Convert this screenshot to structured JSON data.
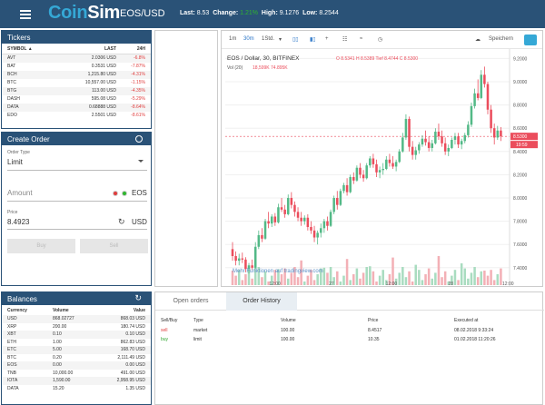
{
  "header": {
    "logo_part1": "Coin",
    "logo_part2": "Sim",
    "pair": "EOS/USD",
    "last_label": "Last:",
    "last_value": "8.53",
    "change_label": "Change:",
    "change_value": "1.21%",
    "high_label": "High:",
    "high_value": "9.1276",
    "low_label": "Low:",
    "low_value": "8.2544"
  },
  "tickers": {
    "title": "Tickers",
    "col_symbol": "SYMBOL ▲",
    "col_last": "LAST",
    "col_24h": "24H",
    "rows": [
      {
        "symbol": "AVT",
        "last": "2.0306 USD",
        "change": "-6.8%"
      },
      {
        "symbol": "BAT",
        "last": "0.3531 USD",
        "change": "-7.87%"
      },
      {
        "symbol": "BCH",
        "last": "1,215.80 USD",
        "change": "-4.31%"
      },
      {
        "symbol": "BTC",
        "last": "10,557.00 USD",
        "change": "-1.15%"
      },
      {
        "symbol": "BTG",
        "last": "113.00 USD",
        "change": "-4.35%"
      },
      {
        "symbol": "DASH",
        "last": "595.08 USD",
        "change": "-5.29%"
      },
      {
        "symbol": "DATA",
        "last": "0.68888 USD",
        "change": "-8.64%"
      },
      {
        "symbol": "EDO",
        "last": "2.5501 USD",
        "change": "-8.61%"
      }
    ]
  },
  "order": {
    "title": "Create Order",
    "type_label": "Order Type",
    "type_value": "Limit",
    "amount_placeholder": "Amount",
    "amount_currency": "EOS",
    "price_label": "Price",
    "price_value": "8.4923",
    "price_currency": "USD",
    "buy_label": "Buy",
    "sell_label": "Sell"
  },
  "balances": {
    "title": "Balances",
    "col_currency": "Currency",
    "col_volume": "Volume",
    "col_value": "Value",
    "rows": [
      {
        "currency": "USD",
        "volume": "868.02727",
        "value": "868.03 USD"
      },
      {
        "currency": "XRP",
        "volume": "200.00",
        "value": "180.74 USD"
      },
      {
        "currency": "XBT",
        "volume": "0.10",
        "value": "0.10 USD"
      },
      {
        "currency": "ETH",
        "volume": "1.00",
        "value": "862.83 USD"
      },
      {
        "currency": "ETC",
        "volume": "5.00",
        "value": "168.70 USD"
      },
      {
        "currency": "BTC",
        "volume": "0.20",
        "value": "2,111.49 USD"
      },
      {
        "currency": "EOS",
        "volume": "0.00",
        "value": "0.00 USD"
      },
      {
        "currency": "TNB",
        "volume": "10,000.00",
        "value": "491.00 USD"
      },
      {
        "currency": "IOTA",
        "volume": "1,590.00",
        "value": "2,958.95 USD"
      },
      {
        "currency": "DATA",
        "volume": "15.20",
        "value": "1.35 USD"
      }
    ]
  },
  "chart_toolbar": {
    "tf_1m": "1m",
    "tf_30m": "30m",
    "tf_1d": "1Std.",
    "save_label": "Speichern"
  },
  "chart_data": {
    "type": "candlestick",
    "title": "EOS / Dollar, 30, BITFINEX",
    "ohlc_o": "O 8.5341",
    "ohlc_h": "H 8.5389",
    "ohlc_l": "Tief 8.4744",
    "ohlc_c": "C 8.5300",
    "vol_label": "Vol (20)",
    "vol_value1": "18,599K",
    "vol_value2": "74.895K",
    "price_tag_current": "8.5300",
    "price_tag_time": "19:59",
    "ylim": [
      7.25,
      9.25
    ],
    "yticks": [
      "9.2000",
      "9.0000",
      "8.8000",
      "8.6000",
      "8.4000",
      "8.2000",
      "8.0000",
      "7.8000",
      "7.6000",
      "7.4000"
    ],
    "xticks": [
      "12:00",
      "27",
      "12:00",
      "28",
      "12:00"
    ],
    "watermark": "Mehr Funktionen auf tradingview.com",
    "candles": [
      {
        "o": 7.56,
        "h": 7.62,
        "l": 7.46,
        "c": 7.5
      },
      {
        "o": 7.5,
        "h": 7.54,
        "l": 7.42,
        "c": 7.46
      },
      {
        "o": 7.46,
        "h": 7.52,
        "l": 7.42,
        "c": 7.48
      },
      {
        "o": 7.48,
        "h": 7.53,
        "l": 7.44,
        "c": 7.47
      },
      {
        "o": 7.47,
        "h": 7.49,
        "l": 7.36,
        "c": 7.39
      },
      {
        "o": 7.39,
        "h": 7.44,
        "l": 7.35,
        "c": 7.42
      },
      {
        "o": 7.42,
        "h": 7.47,
        "l": 7.38,
        "c": 7.4
      },
      {
        "o": 7.4,
        "h": 7.62,
        "l": 7.39,
        "c": 7.58
      },
      {
        "o": 7.58,
        "h": 7.72,
        "l": 7.56,
        "c": 7.68
      },
      {
        "o": 7.68,
        "h": 7.74,
        "l": 7.62,
        "c": 7.65
      },
      {
        "o": 7.65,
        "h": 7.82,
        "l": 7.64,
        "c": 7.8
      },
      {
        "o": 7.8,
        "h": 7.88,
        "l": 7.74,
        "c": 7.78
      },
      {
        "o": 7.78,
        "h": 7.86,
        "l": 7.75,
        "c": 7.84
      },
      {
        "o": 7.84,
        "h": 7.87,
        "l": 7.76,
        "c": 7.79
      },
      {
        "o": 7.79,
        "h": 7.95,
        "l": 7.78,
        "c": 7.92
      },
      {
        "o": 7.92,
        "h": 8.0,
        "l": 7.88,
        "c": 7.9
      },
      {
        "o": 7.9,
        "h": 7.94,
        "l": 7.83,
        "c": 7.86
      },
      {
        "o": 7.86,
        "h": 8.03,
        "l": 7.85,
        "c": 8.0
      },
      {
        "o": 8.0,
        "h": 8.05,
        "l": 7.91,
        "c": 7.94
      },
      {
        "o": 7.94,
        "h": 7.97,
        "l": 7.84,
        "c": 7.88
      },
      {
        "o": 7.88,
        "h": 7.92,
        "l": 7.8,
        "c": 7.83
      },
      {
        "o": 7.83,
        "h": 7.88,
        "l": 7.76,
        "c": 7.8
      },
      {
        "o": 7.8,
        "h": 7.85,
        "l": 7.77,
        "c": 7.83
      },
      {
        "o": 7.83,
        "h": 7.86,
        "l": 7.72,
        "c": 7.75
      },
      {
        "o": 7.75,
        "h": 7.8,
        "l": 7.69,
        "c": 7.72
      },
      {
        "o": 7.72,
        "h": 7.76,
        "l": 7.62,
        "c": 7.66
      },
      {
        "o": 7.66,
        "h": 7.72,
        "l": 7.6,
        "c": 7.7
      },
      {
        "o": 7.7,
        "h": 7.78,
        "l": 7.66,
        "c": 7.74
      },
      {
        "o": 7.74,
        "h": 7.82,
        "l": 7.7,
        "c": 7.8
      },
      {
        "o": 7.8,
        "h": 7.84,
        "l": 7.72,
        "c": 7.76
      },
      {
        "o": 7.76,
        "h": 7.9,
        "l": 7.75,
        "c": 7.88
      },
      {
        "o": 7.88,
        "h": 8.02,
        "l": 7.86,
        "c": 8.0
      },
      {
        "o": 8.0,
        "h": 8.06,
        "l": 7.9,
        "c": 7.94
      },
      {
        "o": 7.94,
        "h": 8.08,
        "l": 7.93,
        "c": 8.06
      },
      {
        "o": 8.06,
        "h": 8.13,
        "l": 8.04,
        "c": 8.11
      },
      {
        "o": 8.11,
        "h": 8.17,
        "l": 8.02,
        "c": 8.05
      },
      {
        "o": 8.05,
        "h": 8.2,
        "l": 8.04,
        "c": 8.18
      },
      {
        "o": 8.18,
        "h": 8.22,
        "l": 8.12,
        "c": 8.15
      },
      {
        "o": 8.15,
        "h": 8.28,
        "l": 8.14,
        "c": 8.26
      },
      {
        "o": 8.26,
        "h": 8.3,
        "l": 8.17,
        "c": 8.2
      },
      {
        "o": 8.2,
        "h": 8.24,
        "l": 8.14,
        "c": 8.17
      },
      {
        "o": 8.17,
        "h": 8.3,
        "l": 8.16,
        "c": 8.28
      },
      {
        "o": 8.28,
        "h": 8.36,
        "l": 8.26,
        "c": 8.34
      },
      {
        "o": 8.34,
        "h": 8.38,
        "l": 8.26,
        "c": 8.29
      },
      {
        "o": 8.29,
        "h": 8.33,
        "l": 8.18,
        "c": 8.22
      },
      {
        "o": 8.22,
        "h": 8.27,
        "l": 8.17,
        "c": 8.24
      },
      {
        "o": 8.24,
        "h": 8.3,
        "l": 8.2,
        "c": 8.25
      },
      {
        "o": 8.25,
        "h": 8.36,
        "l": 8.24,
        "c": 8.33
      },
      {
        "o": 8.33,
        "h": 8.38,
        "l": 8.27,
        "c": 8.3
      },
      {
        "o": 8.3,
        "h": 8.36,
        "l": 8.25,
        "c": 8.27
      },
      {
        "o": 8.27,
        "h": 8.33,
        "l": 8.23,
        "c": 8.31
      },
      {
        "o": 8.31,
        "h": 8.42,
        "l": 8.3,
        "c": 8.4
      },
      {
        "o": 8.4,
        "h": 8.56,
        "l": 8.39,
        "c": 8.52
      },
      {
        "o": 8.52,
        "h": 8.72,
        "l": 8.5,
        "c": 8.68
      },
      {
        "o": 8.68,
        "h": 8.7,
        "l": 8.4,
        "c": 8.44
      },
      {
        "o": 8.44,
        "h": 8.49,
        "l": 8.33,
        "c": 8.37
      },
      {
        "o": 8.37,
        "h": 8.44,
        "l": 8.33,
        "c": 8.41
      },
      {
        "o": 8.41,
        "h": 8.48,
        "l": 8.38,
        "c": 8.46
      },
      {
        "o": 8.46,
        "h": 8.54,
        "l": 8.44,
        "c": 8.51
      },
      {
        "o": 8.51,
        "h": 8.58,
        "l": 8.45,
        "c": 8.48
      },
      {
        "o": 8.48,
        "h": 8.53,
        "l": 8.4,
        "c": 8.43
      },
      {
        "o": 8.43,
        "h": 8.5,
        "l": 8.4,
        "c": 8.47
      },
      {
        "o": 8.47,
        "h": 8.6,
        "l": 8.46,
        "c": 8.57
      },
      {
        "o": 8.57,
        "h": 8.64,
        "l": 8.5,
        "c": 8.53
      },
      {
        "o": 8.53,
        "h": 8.58,
        "l": 8.44,
        "c": 8.47
      },
      {
        "o": 8.47,
        "h": 8.52,
        "l": 8.37,
        "c": 8.4
      },
      {
        "o": 8.4,
        "h": 8.46,
        "l": 8.36,
        "c": 8.43
      },
      {
        "o": 8.43,
        "h": 8.52,
        "l": 8.42,
        "c": 8.5
      },
      {
        "o": 8.5,
        "h": 8.56,
        "l": 8.46,
        "c": 8.53
      },
      {
        "o": 8.53,
        "h": 8.56,
        "l": 8.43,
        "c": 8.46
      },
      {
        "o": 8.46,
        "h": 8.51,
        "l": 8.42,
        "c": 8.49
      },
      {
        "o": 8.49,
        "h": 8.56,
        "l": 8.47,
        "c": 8.54
      },
      {
        "o": 8.54,
        "h": 8.66,
        "l": 8.52,
        "c": 8.63
      },
      {
        "o": 8.63,
        "h": 8.82,
        "l": 8.61,
        "c": 8.79
      },
      {
        "o": 8.79,
        "h": 8.94,
        "l": 8.77,
        "c": 8.9
      },
      {
        "o": 8.9,
        "h": 9.02,
        "l": 8.84,
        "c": 8.86
      },
      {
        "o": 8.86,
        "h": 9.1,
        "l": 8.85,
        "c": 9.06
      },
      {
        "o": 9.06,
        "h": 9.13,
        "l": 8.95,
        "c": 8.98
      },
      {
        "o": 8.98,
        "h": 9.0,
        "l": 8.72,
        "c": 8.76
      },
      {
        "o": 8.76,
        "h": 8.8,
        "l": 8.56,
        "c": 8.6
      },
      {
        "o": 8.6,
        "h": 8.64,
        "l": 8.46,
        "c": 8.52
      },
      {
        "o": 8.52,
        "h": 8.62,
        "l": 8.5,
        "c": 8.58
      },
      {
        "o": 8.58,
        "h": 8.61,
        "l": 8.49,
        "c": 8.53
      }
    ]
  },
  "history": {
    "tab_open": "Open orders",
    "tab_history": "Order History",
    "col_side": "Sell/Buy",
    "col_type": "Type",
    "col_volume": "Volume",
    "col_price": "Price",
    "col_executed": "Executed at",
    "rows": [
      {
        "side": "sell",
        "type": "market",
        "volume": "100.00",
        "price": "8.4517",
        "executed": "08.02.2018 9:33:24"
      },
      {
        "side": "buy",
        "type": "limit",
        "volume": "100.00",
        "price": "10.35",
        "executed": "01.02.2018 11:20:26"
      }
    ]
  },
  "colors": {
    "brand": "#2a5277",
    "accent": "#35a8d6",
    "up": "#53b987",
    "down": "#eb4d5c"
  }
}
